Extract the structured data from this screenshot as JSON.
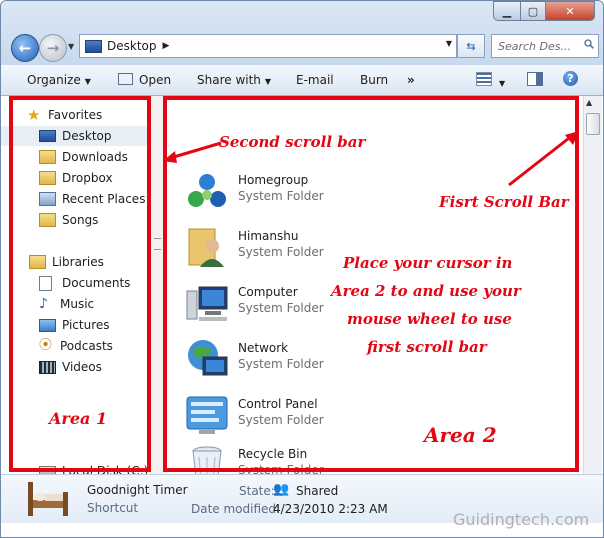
{
  "window": {
    "controls": {
      "minimize": "▁",
      "maximize": "▢",
      "close": "✕"
    }
  },
  "address": {
    "location": "Desktop",
    "search_placeholder": "Search Des..."
  },
  "toolbar": {
    "organize": "Organize",
    "open": "Open",
    "share_with": "Share with",
    "email": "E-mail",
    "burn": "Burn",
    "more": "»"
  },
  "nav": {
    "favorites": "Favorites",
    "favorites_items": [
      "Desktop",
      "Downloads",
      "Dropbox",
      "Recent Places",
      "Songs"
    ],
    "libraries": "Libraries",
    "libraries_items": [
      "Documents",
      "Music",
      "Pictures",
      "Podcasts",
      "Videos"
    ],
    "partial_item": "Local Disk (C:)"
  },
  "files": [
    {
      "name": "Homegroup",
      "type": "System Folder",
      "icon": "homegroup-icon"
    },
    {
      "name": "Himanshu",
      "type": "System Folder",
      "icon": "user-folder-icon"
    },
    {
      "name": "Computer",
      "type": "System Folder",
      "icon": "computer-icon"
    },
    {
      "name": "Network",
      "type": "System Folder",
      "icon": "network-icon"
    },
    {
      "name": "Control Panel",
      "type": "System Folder",
      "icon": "control-panel-icon"
    },
    {
      "name": "Recycle Bin",
      "type": "System Folder",
      "icon": "recycle-bin-icon"
    }
  ],
  "annotations": {
    "second_scroll_bar": "Second scroll bar",
    "first_scroll_bar": "Fisrt Scroll Bar",
    "instruction_line1": "Place your cursor in",
    "instruction_line2": "Area 2 to and use your",
    "instruction_line3": "mouse wheel to use",
    "instruction_line4": "first scroll bar",
    "area1": "Area 1",
    "area2": "Area 2",
    "color": "#e30613"
  },
  "details": {
    "name": "Goodnight Timer",
    "kind": "Shortcut",
    "state_label": "State:",
    "state_value": "Shared",
    "date_label": "Date modified:",
    "date_value": "4/23/2010 2:23 AM"
  },
  "watermark": "Guidingtech.com"
}
